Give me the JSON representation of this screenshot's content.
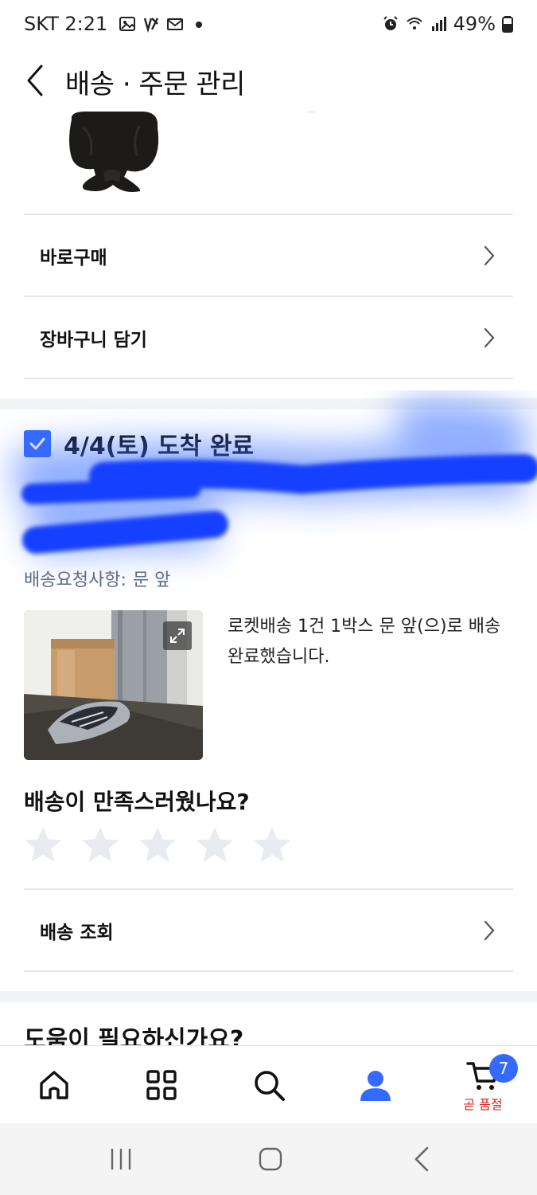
{
  "status_bar": {
    "carrier_time": "SKT 2:21",
    "battery": "49%"
  },
  "header": {
    "title": "배송 · 주문 관리"
  },
  "product_actions": {
    "buy_now": "바로구매",
    "add_to_cart": "장바구니 담기"
  },
  "delivery": {
    "arrival_status": "4/4(토) 도착 완료",
    "request_label": "배송요청사항:",
    "request_value": "문 앞",
    "message": "로켓배송 1건 1박스 문 앞(으)로 배송 완료했습니다."
  },
  "rating": {
    "question": "배송이 만족스러웠나요?",
    "max_stars": 5,
    "selected": 0
  },
  "tracking": {
    "label": "배송 조회"
  },
  "help": {
    "title": "도움이 필요하신가요?"
  },
  "bottom_nav": {
    "cart_badge": "7",
    "cart_label": "곧 품절",
    "active_item": "my-account",
    "accent_color": "#346aff"
  },
  "colors": {
    "accent": "#346aff",
    "warning": "#e02020"
  }
}
